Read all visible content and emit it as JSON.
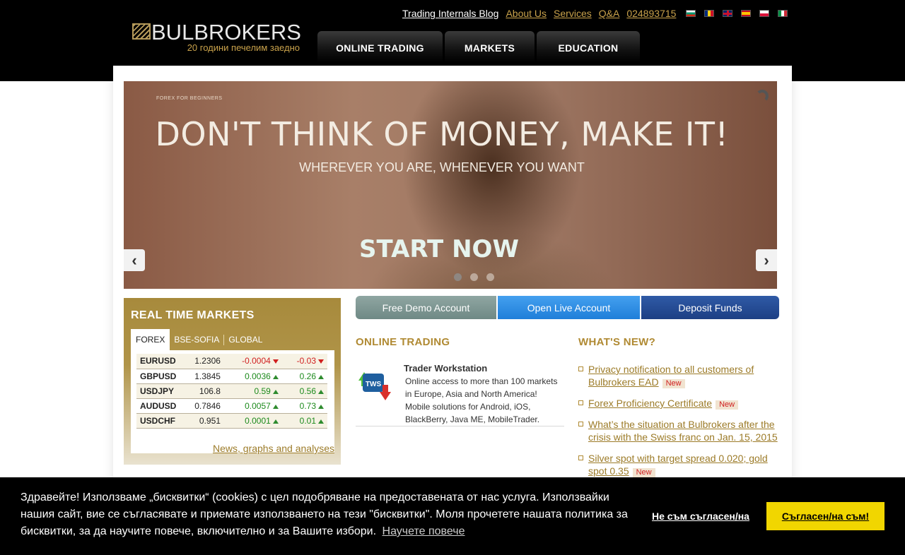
{
  "brand": {
    "name": "BULBROKERS",
    "tagline": "20 години печелим заедно",
    "gold": "#c9a24b"
  },
  "top_links": {
    "blog": "Trading Internals Blog",
    "about": "About Us",
    "services": "Services",
    "qa": "Q&A",
    "phone": "024893715"
  },
  "flags": [
    "bg-flag-icon",
    "ro-flag-icon",
    "gb-flag-icon",
    "es-flag-icon",
    "pl-flag-icon",
    "it-flag-icon"
  ],
  "nav": {
    "tabs": [
      {
        "label": "ONLINE TRADING"
      },
      {
        "label": "MARKETS"
      },
      {
        "label": "EDUCATION"
      }
    ]
  },
  "banner": {
    "kicker": "FOREX FOR BEGINNERS",
    "title": "DON'T THINK OF MONEY, MAKE IT!",
    "subtitle": "WHEREVER YOU ARE, WHENEVER YOU WANT",
    "cta": "START NOW",
    "prev": "‹",
    "next": "›",
    "slides": 3,
    "active_slide": 1
  },
  "markets": {
    "title": "REAL TIME MARKETS",
    "tabs": [
      {
        "label": "FOREX"
      },
      {
        "label": "BSE-SOFIA"
      },
      {
        "label": "GLOBAL"
      }
    ],
    "rows": [
      {
        "symbol": "EURUSD",
        "price": "1.2306",
        "change": "-0.0004",
        "pct": "-0.03",
        "dir": "down"
      },
      {
        "symbol": "GBPUSD",
        "price": "1.3845",
        "change": "0.0036",
        "pct": "0.26",
        "dir": "up"
      },
      {
        "symbol": "USDJPY",
        "price": "106.8",
        "change": "0.59",
        "pct": "0.56",
        "dir": "up"
      },
      {
        "symbol": "AUDUSD",
        "price": "0.7846",
        "change": "0.0057",
        "pct": "0.73",
        "dir": "up"
      },
      {
        "symbol": "USDCHF",
        "price": "0.951",
        "change": "0.0001",
        "pct": "0.01",
        "dir": "up"
      }
    ],
    "more_link": "News, graphs and analyses"
  },
  "accounts": {
    "demo": "Free Demo Account",
    "live": "Open Live Account",
    "deposit": "Deposit Funds"
  },
  "online_trading": {
    "title": "ONLINE TRADING",
    "product_title": "Trader Workstation",
    "product_icon_text": "TWS",
    "product_desc": "Online access to more than 100 markets in Europe, Asia and North America! Mobile solutions for Android, iOS, BlackBerry, Java ME, MobileTrader."
  },
  "whats_new": {
    "title": "WHAT'S NEW?",
    "badge": "New",
    "items": [
      {
        "text": "Privacy notification to all customers of Bulbrokers EAD",
        "new": true
      },
      {
        "text": "Forex Proficiency Certificate",
        "new": true
      },
      {
        "text": "What’s the situation at Bulbrokers after the crisis with the Swiss franc on Jan. 15, 2015",
        "new": false
      },
      {
        "text": "Silver spot with target spread 0.020; gold spot 0.35",
        "new": true
      }
    ]
  },
  "cookie": {
    "text": "Здравейте! Използваме „бисквитки“ (cookies) с цел подобряване на предоставената от нас услуга. Използвайки нашия сайт, вие се съгласявате и приемате използването на тези \"бисквитки\". Моля прочетете нашата политика за бисквитки, за да научите повече, включително и за Вашите избори.",
    "learn_more": "Научете повече",
    "decline": "Не съм съгласен/на",
    "accept": "Съгласен/на съм!",
    "accept_color": "#f1d600"
  }
}
